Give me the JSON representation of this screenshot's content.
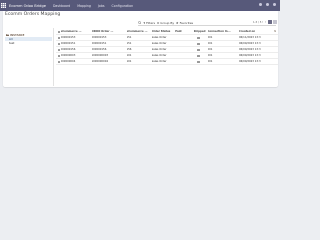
{
  "topnav": {
    "brand": "Ecomm Odoo Bridge",
    "items": [
      "Dashboard",
      "Mapping",
      "Jobs",
      "Configuration"
    ]
  },
  "page": {
    "title": "Ecomm Orders Mapping"
  },
  "search": {
    "filters_label": "Filters",
    "groupby_label": "Group By",
    "favorites_label": "Favorites",
    "placeholder": ""
  },
  "pager": {
    "text": "1-5 / 5"
  },
  "left_panel": {
    "header": "INSTANCE",
    "items": [
      {
        "label": "All",
        "active": true
      },
      {
        "label": "test",
        "active": false
      }
    ]
  },
  "table": {
    "columns": [
      "eCommerce ...",
      "ODOO Order ...",
      "eCommerce ...",
      "Order Status",
      "Shipped",
      "Connection In...",
      "Created on"
    ],
    "hidden_field_label": "Paid",
    "rows": [
      {
        "ecom_id": "000000153",
        "odoo_order": "000000153",
        "ecom_num": "151",
        "status": "Sales Order",
        "conn": "001",
        "created": "06/11/2023 13:3"
      },
      {
        "ecom_id": "000000151",
        "odoo_order": "000000151",
        "ecom_num": "151",
        "status": "Sales Order",
        "conn": "001",
        "created": "06/09/2023 13:3"
      },
      {
        "ecom_id": "000000156",
        "odoo_order": "000000156",
        "ecom_num": "156",
        "status": "Sales Order",
        "conn": "001",
        "created": "06/09/2023 13:3"
      },
      {
        "ecom_id": "000000003",
        "odoo_order": "1000000003",
        "ecom_num": "101",
        "status": "Sales Order",
        "conn": "001",
        "created": "06/09/2023 13:3"
      },
      {
        "ecom_id": "000000004",
        "odoo_order": "1000000004",
        "ecom_num": "101",
        "status": "Sales Order",
        "conn": "001",
        "created": "06/09/2023 13:3"
      }
    ]
  },
  "colors": {
    "topnav": "#57597a",
    "accent": "#714b67",
    "active_row": "#e2ebf5",
    "page_bg": "#eceef2"
  },
  "icons": {
    "apps": "apps-grid-icon",
    "search": "search-icon",
    "filter": "filter-icon",
    "group": "groupby-icon",
    "favorite": "star-icon",
    "instance": "folder-icon"
  }
}
